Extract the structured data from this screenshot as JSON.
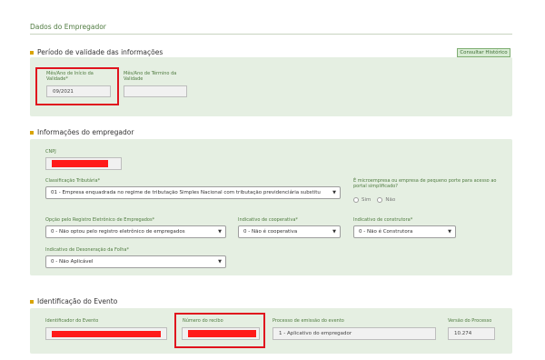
{
  "page": {
    "title": "Dados do Empregador"
  },
  "validity": {
    "heading": "Período de validade das informações",
    "consult_button": "Consultar Histórico",
    "start_label": "Mês/Ano de Início da Validade*",
    "start_value": "09/2021",
    "end_label": "Mês/Ano de Término da Validade",
    "end_value": ""
  },
  "employer": {
    "heading": "Informações do empregador",
    "cnpj_label": "CNPJ",
    "classification_label": "Classificação Tributária*",
    "classification_value": "01 - Empresa enquadrada no regime de tributação Simples Nacional com tributação previdenciária substitu",
    "micro_label": "É microempresa ou empresa de pequeno porte para acesso ao portal simplificado?",
    "micro_yes": "Sim",
    "micro_no": "Não",
    "electronic_label": "Opção pelo Registro Eletrônico de Empregados*",
    "electronic_value": "0 - Não optou pelo registro eletrônico de empregados",
    "coop_label": "Indicativo de cooperativa*",
    "coop_value": "0 - Não é cooperativa",
    "constr_label": "Indicativo de construtora*",
    "constr_value": "0 - Não é Construtora",
    "payroll_label": "Indicativo de Desoneração da Folha*",
    "payroll_value": "0 - Não Aplicável"
  },
  "event": {
    "heading": "Identificação do Evento",
    "id_label": "Identificador do Evento",
    "receipt_label": "Número do recibo",
    "process_label": "Processo de emissão do evento",
    "process_value": "1 - Aplicativo do empregador",
    "version_label": "Versão do Processo",
    "version_value": "10.274"
  },
  "colors": {
    "accent": "#4e7a3f",
    "panel": "#e5efe2",
    "redaction": "#ff1a1a",
    "highlight": "#e0141e",
    "bullet": "#d9a400"
  }
}
